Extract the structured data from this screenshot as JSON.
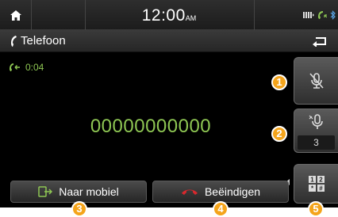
{
  "statusbar": {
    "home_icon": "home-icon",
    "time": "12:00",
    "ampm": "AM",
    "icons": [
      "signal-icon",
      "phone-call-icon",
      "bluetooth-icon"
    ]
  },
  "header": {
    "title": "Telefoon",
    "icon": "handset-icon",
    "back_icon": "back-arrow-icon"
  },
  "call": {
    "duration": "0:04",
    "number": "00000000000"
  },
  "side_buttons": {
    "mute_icon": "microphone-mute-icon",
    "mic_icon": "microphone-volume-icon",
    "mic_level": "3",
    "keypad_label": "1 2 * #"
  },
  "bottom_buttons": {
    "transfer_label": "Naar mobiel",
    "end_label": "Beëindigen"
  },
  "callouts": [
    "1",
    "2",
    "3",
    "4",
    "5"
  ],
  "colors": {
    "accent_green": "#8ec653",
    "end_call_red": "#d8282d",
    "callout_orange": "#f4a41b"
  }
}
